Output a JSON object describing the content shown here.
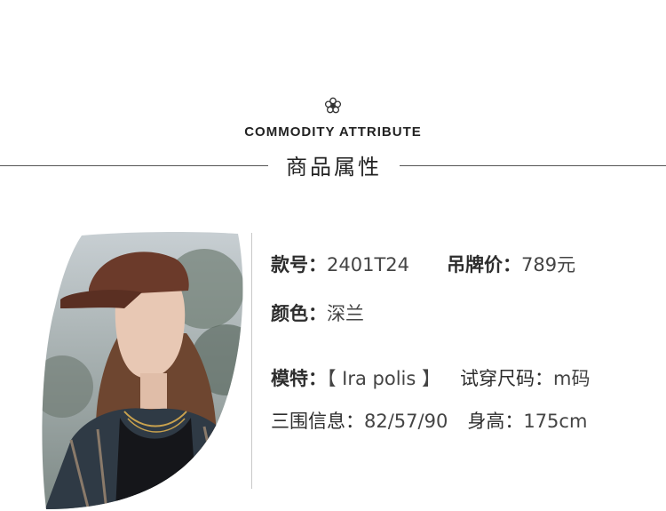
{
  "header": {
    "icon": "flower-icon",
    "subtitle_en": "COMMODITY ATTRIBUTE",
    "title_cn": "商品属性"
  },
  "photo": {
    "alt": "模特照片"
  },
  "attributes": {
    "style_no_label": "款号：",
    "style_no_value": "2401T24",
    "price_label": "吊牌价：",
    "price_value": "789元",
    "color_label": "颜色：",
    "color_value": "深兰",
    "model_label": "模特：",
    "model_value": "【 Ira polis 】",
    "size_label": "试穿尺码：",
    "size_value": "m码",
    "measure_label": "三围信息：",
    "measure_value": "82/57/90",
    "height_label": "身高：",
    "height_value": "175cm"
  },
  "colors": {
    "text": "#3a3a3a",
    "rule": "#555555",
    "divider": "#c8c8c8"
  }
}
